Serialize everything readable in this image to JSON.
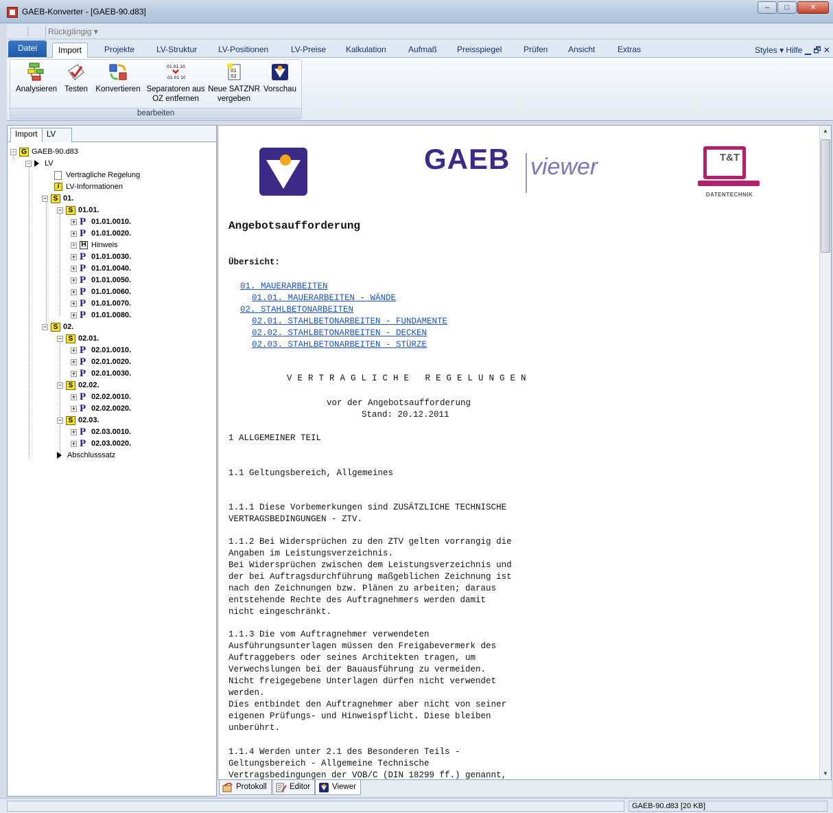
{
  "window": {
    "title": "GAEB-Konverter - [GAEB-90.d83]",
    "min": "–",
    "max": "□",
    "close": "✕"
  },
  "qat": {
    "undo": "Rückgängig ▾"
  },
  "ribbon_tabs": [
    "Datei",
    "Import",
    "Projekte",
    "LV-Struktur",
    "LV-Positionen",
    "LV-Preise",
    "Kalkulation",
    "Aufmaß",
    "Preisspiegel",
    "Prüfen",
    "Ansicht",
    "Extras"
  ],
  "ribbon_right": "Styles ▾  Hilfe  ▁  🗗  ✕",
  "ribbon": {
    "group_label": "bearbeiten",
    "buttons": {
      "analysieren": "Analysieren",
      "testen": "Testen",
      "konvertieren": "Konvertieren",
      "separatoren_l1": "Separatoren aus",
      "separatoren_l2": "OZ entfernen",
      "satznr_l1": "Neue SATZNR",
      "satznr_l2": "vergeben",
      "vorschau": "Vorschau"
    }
  },
  "left_tabs": {
    "import": "Import",
    "lv": "LV"
  },
  "tree": {
    "root": "GAEB-90.d83",
    "lv": "LV",
    "vertragliche": "Vertragliche Regelung",
    "lvinfo": "LV-Informationen",
    "s01": "01.",
    "s0101": "01.01.",
    "p010100010": "01.01.0010.",
    "p010100020": "01.01.0020.",
    "hinweis": "Hinweis",
    "p010100030": "01.01.0030.",
    "p010100040": "01.01.0040.",
    "p010100050": "01.01.0050.",
    "p010100060": "01.01.0060.",
    "p010100070": "01.01.0070.",
    "p010100080": "01.01.0080.",
    "s02": "02.",
    "s0201": "02.01.",
    "p020100010": "02.01.0010.",
    "p020100020": "02.01.0020.",
    "p020100030": "02.01.0030.",
    "s0202": "02.02.",
    "p020200010": "02.02.0010.",
    "p020200020": "02.02.0020.",
    "s0203": "02.03.",
    "p020300010": "02.03.0010.",
    "p020300020": "02.03.0020.",
    "abschluss": "Abschlusssatz"
  },
  "viewer": {
    "logo_gaeb": "GAEB",
    "logo_viewer": "viewer",
    "logo_tt": "T&T",
    "logo_tt_sub": "DATENTECHNIK",
    "heading": "Angebotsaufforderung",
    "overview": "Übersicht:",
    "toc": [
      "01. MAUERARBEITEN",
      "01.01. MAUERARBEITEN - WÄNDE",
      "02. STAHLBETONARBEITEN",
      "02.01. STAHLBETONARBEITEN - FUNDAMENTE",
      "02.02. STAHLBETONARBEITEN - DECKEN",
      "02.03. STAHLBETONARBEITEN - STÜRZE"
    ],
    "vr_title": "VERTRAGLICHE REGELUNGEN",
    "vr_sub1": "vor der Angebotsaufforderung",
    "vr_sub2": "Stand: 20.12.2011",
    "s1": "1 ALLGEMEINER TEIL",
    "s11": "1.1 Geltungsbereich, Allgemeines",
    "p111": "1.1.1 Diese Vorbemerkungen sind ZUSÄTZLICHE TECHNISCHE\nVERTRAGSBEDINGUNGEN - ZTV.",
    "p112": "1.1.2 Bei Widersprüchen zu den ZTV gelten vorrangig die\nAngaben im Leistungsverzeichnis.\nBei Widersprüchen zwischen dem Leistungsverzeichnis und\nder bei Auftragsdurchführung maßgeblichen Zeichnung ist\nnach den Zeichnungen bzw. Plänen zu arbeiten; daraus\nentstehende Rechte des Auftragnehmers werden damit\nnicht eingeschränkt.",
    "p113": "1.1.3 Die vom Auftragnehmer verwendeten\nAusführungsunterlagen müssen den Freigabevermerk des\nAuftraggebers oder seines Architekten tragen, um\nVerwechslungen bei der Bauausführung zu vermeiden.\nNicht freigegebene Unterlagen dürfen nicht verwendet\nwerden.\nDies entbindet den Auftragnehmer aber nicht von seiner\neigenen Prüfungs- und Hinweispflicht. Diese bleiben\nunberührt.",
    "p114": "1.1.4 Werden unter 2.1 des Besonderen Teils -\nGeltungsbereich - Allgemeine Technische\nVertragsbedingungen der VOB/C (DIN 18299 ff.) genannt,"
  },
  "bottom_tabs": {
    "protokoll": "Protokoll",
    "editor": "Editor",
    "viewer": "Viewer"
  },
  "status": {
    "file": "GAEB-90.d83 [20 KB]"
  }
}
